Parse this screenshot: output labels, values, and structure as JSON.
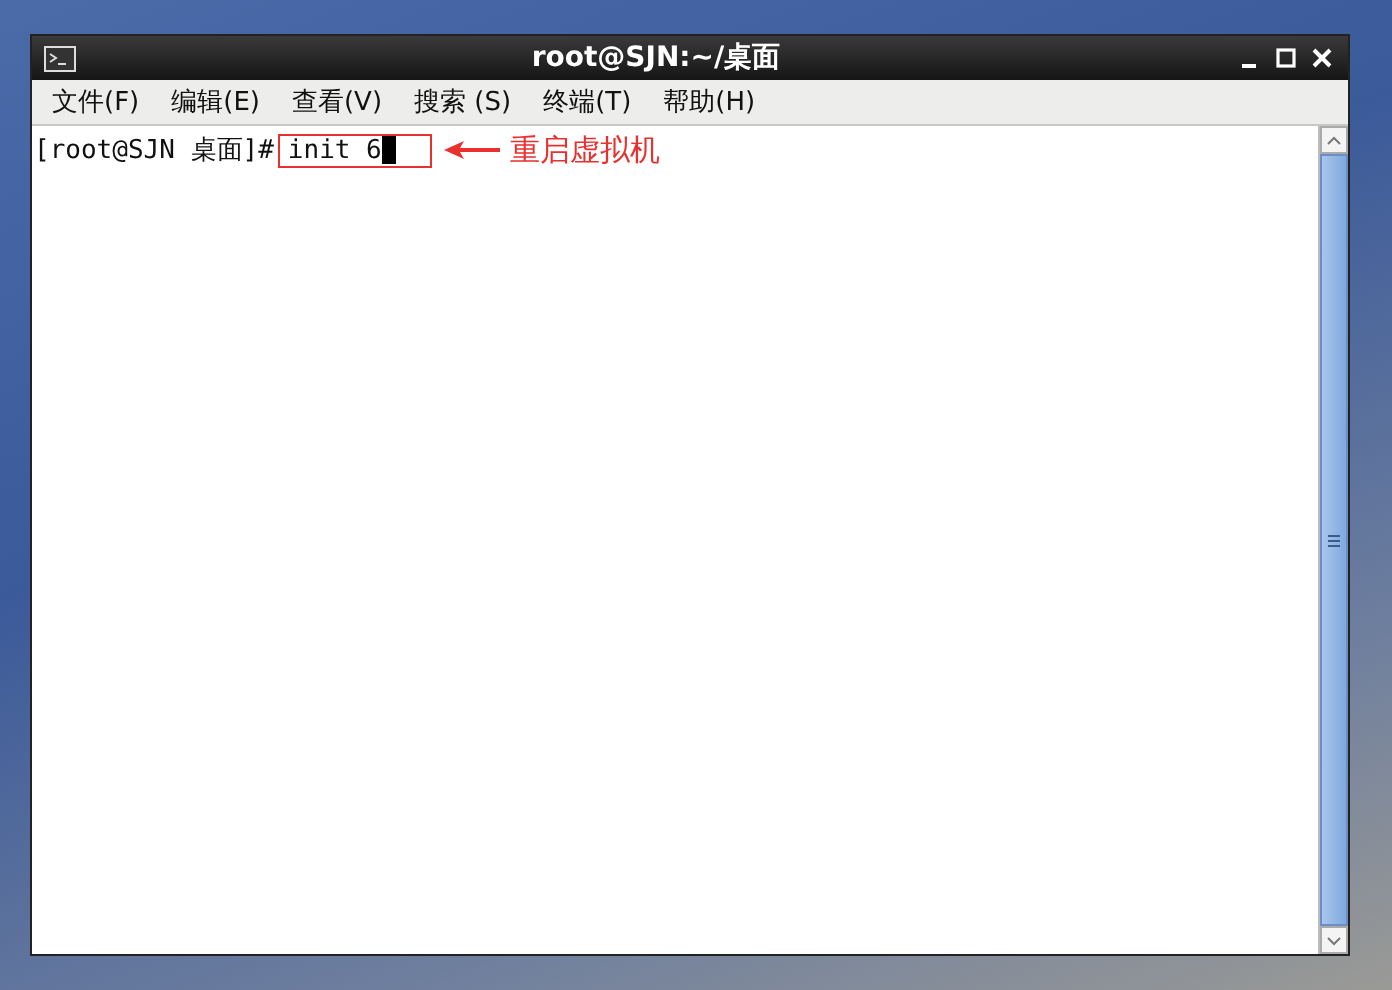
{
  "window": {
    "title": "root@SJN:~/桌面"
  },
  "menu": [
    {
      "label": "文件(F)"
    },
    {
      "label": "编辑(E)"
    },
    {
      "label": "查看(V)"
    },
    {
      "label": "搜索 (S)"
    },
    {
      "label": "终端(T)"
    },
    {
      "label": "帮助(H)"
    }
  ],
  "terminal": {
    "prompt": "[root@SJN 桌面]#",
    "command": "init 6",
    "cursor_visible": true
  },
  "annotation": {
    "text": "重启虚拟机"
  }
}
